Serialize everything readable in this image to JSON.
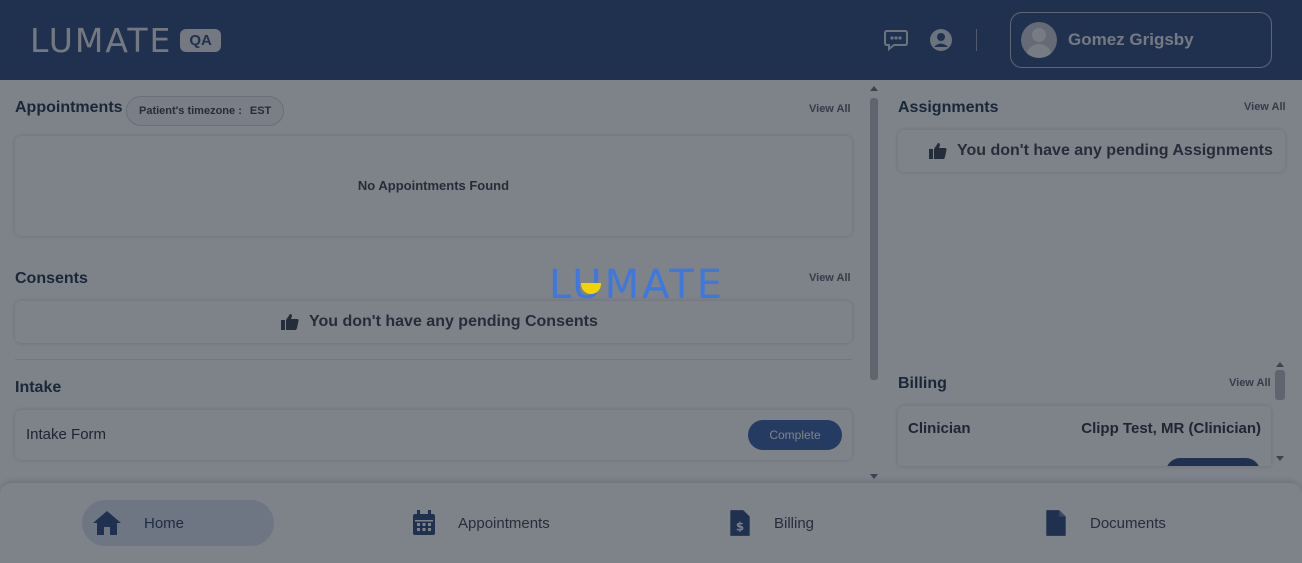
{
  "header": {
    "logo_text": "LUMATE",
    "env_badge": "QA",
    "chat_icon": "chat-bubble-icon",
    "account_icon": "user-circle-icon",
    "user_name": "Gomez Grigsby"
  },
  "appointments": {
    "title": "Appointments",
    "timezone_label": "Patient's timezone :",
    "timezone_value": "EST",
    "view_all": "View All",
    "empty_text": "No Appointments Found"
  },
  "consents": {
    "title": "Consents",
    "view_all": "View All",
    "pending_text": "You don't have any pending Consents"
  },
  "intake": {
    "title": "Intake",
    "form_name": "Intake Form",
    "status_button": "Complete"
  },
  "assignments": {
    "title": "Assignments",
    "view_all": "View All",
    "pending_text": "You don't have any pending Assignments"
  },
  "billing": {
    "title": "Billing",
    "view_all": "View All",
    "row_label": "Clinician",
    "row_value": "Clipp Test, MR (Clinician)"
  },
  "loader": {
    "logo_text": "LUMATE"
  },
  "nav": {
    "items": [
      {
        "label": "Home",
        "icon": "home-icon",
        "active": true
      },
      {
        "label": "Appointments",
        "icon": "calendar-icon",
        "active": false
      },
      {
        "label": "Billing",
        "icon": "invoice-icon",
        "active": false
      },
      {
        "label": "Documents",
        "icon": "document-icon",
        "active": false
      }
    ]
  },
  "colors": {
    "header_bg": "#2f4d7e",
    "accent": "#3a62a8",
    "loader_blue": "#3d78e0",
    "loader_yellow": "#f4d400"
  }
}
